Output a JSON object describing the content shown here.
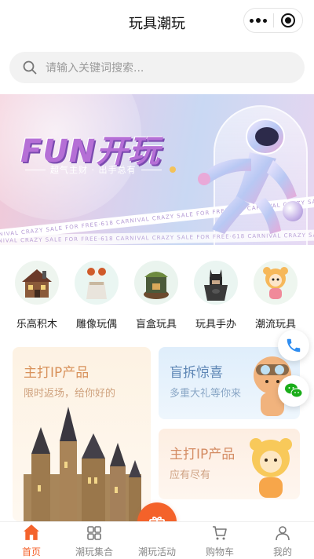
{
  "app": {
    "title": "玩具潮玩"
  },
  "search": {
    "placeholder": "请输入关键词搜索..."
  },
  "banner": {
    "headline": "FUN开玩",
    "subline": "超气主财 · 出手总有",
    "ribbon_text": "CARNIVAL CRAZY SALE FOR FREE·618 CARNIVAL CRAZY SALE FOR FREE·618 CARNIVAL CRAZY SALE FOR FREE"
  },
  "categories": [
    {
      "label": "乐高积木",
      "icon": "lego-house-image"
    },
    {
      "label": "雕像玩偶",
      "icon": "clown-figure-image"
    },
    {
      "label": "盲盒玩具",
      "icon": "blind-box-image"
    },
    {
      "label": "玩具手办",
      "icon": "batman-figure-image"
    },
    {
      "label": "潮流玩具",
      "icon": "trend-toy-image"
    }
  ],
  "promos": {
    "main_ip": {
      "title": "主打IP产品",
      "subtitle": "限时返场，给你好的"
    },
    "blind_box": {
      "title": "盲拆惊喜",
      "subtitle": "多重大礼等你来"
    },
    "ip_product": {
      "title": "主打IP产品",
      "subtitle": "应有尽有"
    }
  },
  "floating": {
    "phone_icon": "phone-icon",
    "wechat_icon": "wechat-icon"
  },
  "tabbar": {
    "items": [
      {
        "label": "首页",
        "icon": "home-icon",
        "active": true
      },
      {
        "label": "潮玩集合",
        "icon": "grid-icon",
        "active": false
      },
      {
        "label": "潮玩活动",
        "icon": "gift-icon",
        "active": false
      },
      {
        "label": "购物车",
        "icon": "cart-icon",
        "active": false
      },
      {
        "label": "我的",
        "icon": "user-icon",
        "active": false
      }
    ]
  },
  "colors": {
    "accent": "#f4632c",
    "tab_inactive": "#888888"
  }
}
